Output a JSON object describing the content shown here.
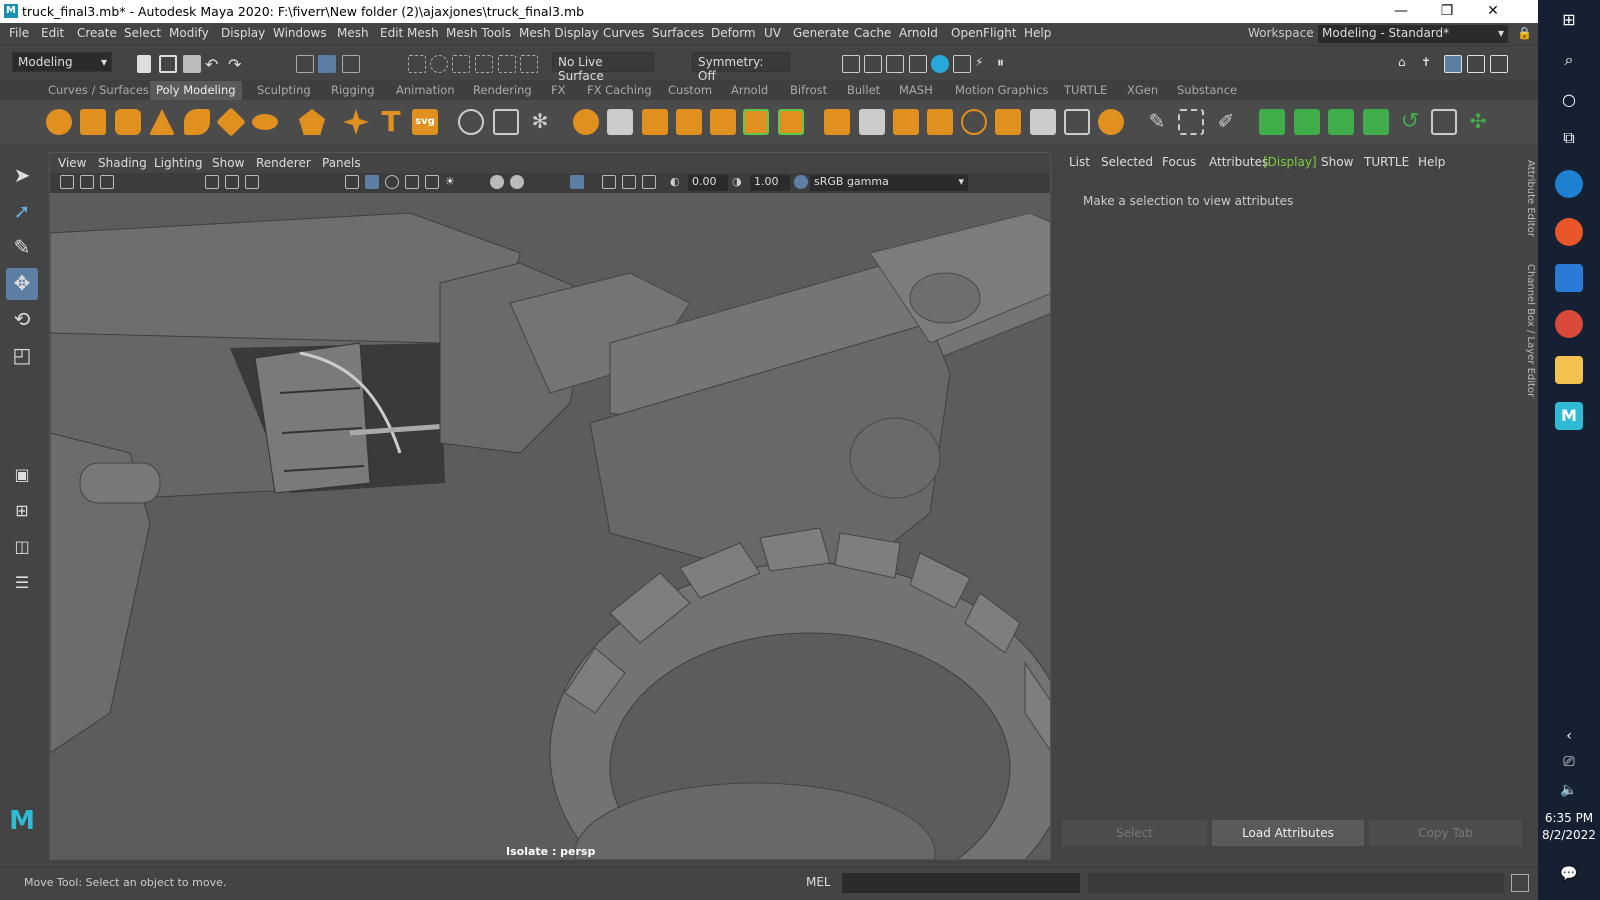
{
  "window": {
    "title": "truck_final3.mb* - Autodesk Maya 2020: F:\\fiverr\\New folder (2)\\ajaxjones\\truck_final3.mb",
    "minimize": "—",
    "restore": "❐",
    "close": "✕"
  },
  "menu": [
    "File",
    "Edit",
    "Create",
    "Select",
    "Modify",
    "Display",
    "Windows",
    "Mesh",
    "Edit Mesh",
    "Mesh Tools",
    "Mesh Display",
    "Curves",
    "Surfaces",
    "Deform",
    "UV",
    "Generate",
    "Cache",
    "Arnold",
    "OpenFlight",
    "Help"
  ],
  "workspace": {
    "label": "Workspace :",
    "value": "Modeling - Standard*"
  },
  "status": {
    "mode": "Modeling",
    "live_surface": "No Live Surface",
    "symmetry": "Symmetry: Off"
  },
  "shelf_tabs": [
    "Curves / Surfaces",
    "Poly Modeling",
    "Sculpting",
    "Rigging",
    "Animation",
    "Rendering",
    "FX",
    "FX Caching",
    "Custom",
    "Arnold",
    "Bifrost",
    "Bullet",
    "MASH",
    "Motion Graphics",
    "TURTLE",
    "XGen",
    "Substance"
  ],
  "shelf_tab_active": "Poly Modeling",
  "viewport": {
    "menu": [
      "View",
      "Shading",
      "Lighting",
      "Show",
      "Renderer",
      "Panels"
    ],
    "exposure": "0.00",
    "gamma": "1.00",
    "color_space": "sRGB gamma",
    "camera_label": "Isolate : persp"
  },
  "attribute_editor": {
    "menu": [
      "List",
      "Selected",
      "Focus",
      "Attributes",
      "[Display]",
      "Show",
      "TURTLE",
      "Help"
    ],
    "message": "Make a selection to view attributes",
    "buttons": [
      "Select",
      "Load Attributes",
      "Copy Tab"
    ],
    "side_tabs": [
      "Attribute Editor",
      "Channel Box / Layer Editor"
    ]
  },
  "helpline": {
    "text": "Move Tool: Select an object to move.",
    "lang": "MEL"
  },
  "taskbar": {
    "time": "6:35 PM",
    "date": "8/2/2022"
  },
  "colors": {
    "accent": "#1fa0c8",
    "active_display": "#7ccf3a",
    "maya_logo": "#2dbbd6"
  }
}
